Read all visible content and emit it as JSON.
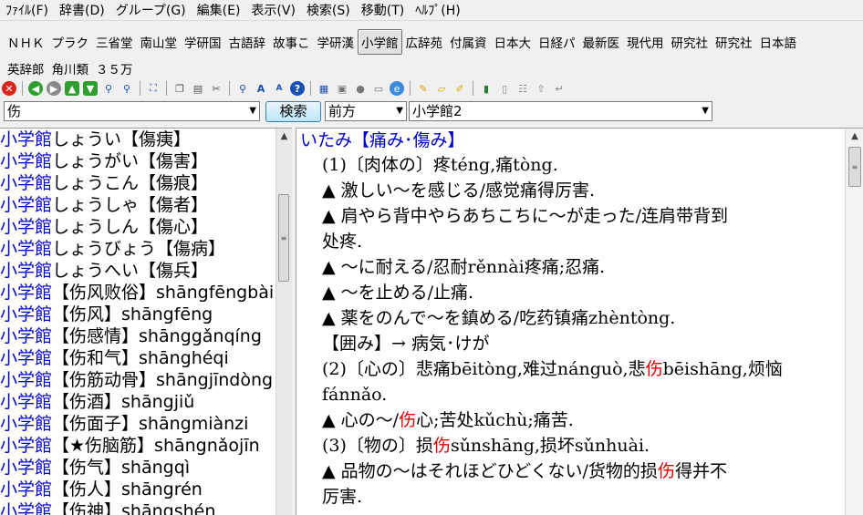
{
  "menu": [
    "ﾌｧｲﾙ(F)",
    "辞書(D)",
    "グループ(G)",
    "編集(E)",
    "表示(V)",
    "検索(S)",
    "移動(T)",
    "ﾍﾙﾌﾟ(H)"
  ],
  "dictionaries_row1": [
    "ＮＨＫ",
    "プラク",
    "三省堂",
    "南山堂",
    "学研国",
    "古語辞",
    "故事こ",
    "学研漢",
    "小学館",
    "広辞苑",
    "付属資",
    "日本大",
    "日経パ",
    "最新医",
    "現代用",
    "研究社",
    "研究社",
    "日本語"
  ],
  "active_dictionary": "小学館",
  "dictionaries_row2": [
    "英辞郎",
    "角川類",
    "３５万"
  ],
  "toolbar_icons": [
    "stop-icon",
    "back-icon",
    "forward-icon",
    "up-icon",
    "down-icon",
    "search-icon",
    "search-prev-icon",
    "fit-icon",
    "copy-icon",
    "paste-icon",
    "cut-icon",
    "zoom-icon",
    "font-up-icon",
    "font-down-icon",
    "help-icon",
    "book-icon",
    "image-icon",
    "speech-icon",
    "link-icon",
    "web-icon",
    "marker-icon",
    "note-icon",
    "pencil-icon",
    "bookmark-icon",
    "page-icon",
    "tree-icon",
    "up-arrow-icon",
    "jump-icon"
  ],
  "search": {
    "query": "伤",
    "button_label": "検索",
    "mode": "前方",
    "dictionary": "小学館2"
  },
  "list": [
    {
      "src": "小学館",
      "text": "しょうい【傷痍】"
    },
    {
      "src": "小学館",
      "text": "しょうがい【傷害】"
    },
    {
      "src": "小学館",
      "text": "しょうこん【傷痕】"
    },
    {
      "src": "小学館",
      "text": "しょうしゃ【傷者】"
    },
    {
      "src": "小学館",
      "text": "しょうしん【傷心】"
    },
    {
      "src": "小学館",
      "text": "しょうびょう【傷病】"
    },
    {
      "src": "小学館",
      "text": "しょうへい【傷兵】"
    },
    {
      "src": "小学館",
      "text": "【伤风败俗】shāngfēngbài"
    },
    {
      "src": "小学館",
      "text": "【伤风】shāngfēng"
    },
    {
      "src": "小学館",
      "text": "【伤感情】shānggǎnqíng"
    },
    {
      "src": "小学館",
      "text": "【伤和气】shānghéqi"
    },
    {
      "src": "小学館",
      "text": "【伤筋动骨】shāngjīndònggǔ"
    },
    {
      "src": "小学館",
      "text": "【伤酒】shāngjiǔ"
    },
    {
      "src": "小学館",
      "text": "【伤面子】shāngmiànzi"
    },
    {
      "src": "小学館",
      "text": "【★伤脑筋】shāngnǎojīn"
    },
    {
      "src": "小学館",
      "text": "【伤气】shāngqì"
    },
    {
      "src": "小学館",
      "text": "【伤人】shāngrén"
    },
    {
      "src": "小学館",
      "text": "【伤神】shāngshén"
    }
  ],
  "entry": {
    "headword": "いたみ【痛み･傷み】",
    "lines": [
      {
        "pre": "(1)〔肉体の〕疼téng,痛tòng.",
        "hl": "",
        "post": ""
      },
      {
        "pre": "▲ 激しい～を感じる/感觉痛得厉害.",
        "hl": "",
        "post": ""
      },
      {
        "pre": "▲ 肩やら背中やらあちこちに～が走った/连肩带背到",
        "hl": "",
        "post": ""
      },
      {
        "pre": "处疼.",
        "hl": "",
        "post": ""
      },
      {
        "pre": "▲ ～に耐える/忍耐rěnnài疼痛;忍痛.",
        "hl": "",
        "post": ""
      },
      {
        "pre": "▲ ～を止める/止痛.",
        "hl": "",
        "post": ""
      },
      {
        "pre": "▲ 薬をのんで～を鎮める/吃药镇痛zhèntòng.",
        "hl": "",
        "post": ""
      },
      {
        "pre": "【囲み】→ 病気･けが",
        "hl": "",
        "post": ""
      },
      {
        "pre": "(2)〔心の〕悲痛bēitòng,难过nánguò,悲",
        "hl": "伤",
        "post": "bēishāng,烦恼"
      },
      {
        "pre": "fánnǎo.",
        "hl": "",
        "post": ""
      },
      {
        "pre": "▲ 心の～/",
        "hl": "伤",
        "post": "心;苦处kǔchù;痛苦."
      },
      {
        "pre": "(3)〔物の〕损",
        "hl": "伤",
        "post": "sǔnshāng,损坏sǔnhuài."
      },
      {
        "pre": "▲ 品物の～はそれほどひどくない/货物的损",
        "hl": "伤",
        "post": "得并不"
      },
      {
        "pre": "厉害.",
        "hl": "",
        "post": ""
      }
    ]
  },
  "colors": {
    "link_blue": "#0000cc",
    "highlight_red": "#e00000"
  }
}
